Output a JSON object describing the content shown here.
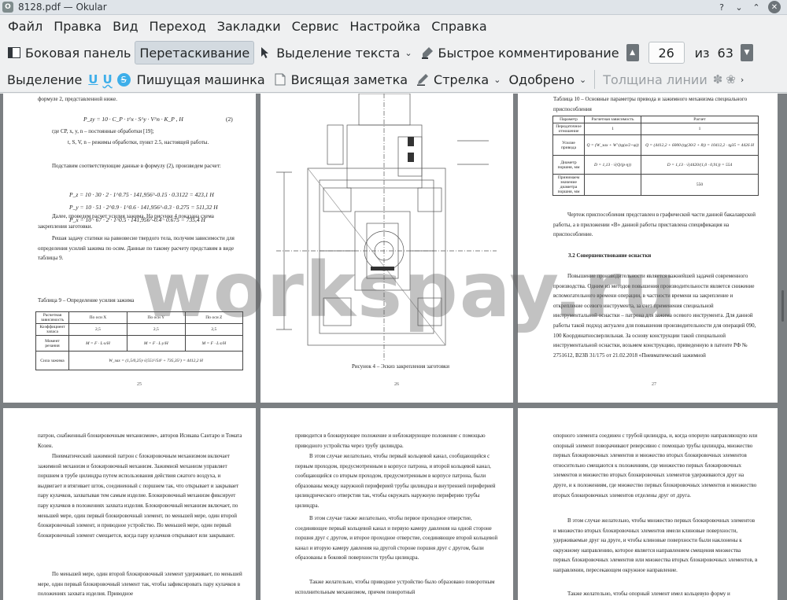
{
  "window": {
    "title": "8128.pdf  — Okular"
  },
  "menu": [
    "Файл",
    "Правка",
    "Вид",
    "Переход",
    "Закладки",
    "Сервис",
    "Настройка",
    "Справка"
  ],
  "toolbar": {
    "sidebar": "Боковая панель",
    "drag": "Перетаскивание",
    "text_select": "Выделение текста",
    "quick_comment": "Быстрое комментирование",
    "page_current": "26",
    "page_of": "из",
    "page_total": "63"
  },
  "annot_toolbar": {
    "highlight": "Выделение",
    "typewriter": "Пишущая машинка",
    "note": "Висящая заметка",
    "arrow": "Стрелка",
    "stamp": "Одобрено",
    "line_width": "Толщина линии"
  },
  "watermark": "workspay.ru",
  "pages": {
    "p25": {
      "top": "формуле 2, представленной ниже.",
      "formula_main": "P_zy = 10 · C_P · t^x · S^y · V^n · K_P , Н",
      "formula_num": "(2)",
      "where1": "где CP, x, y, n – постоянные обработки [19];",
      "where2": "t, S, V, n – режимы обработки, пункт 2.5, настоящей работы.",
      "sub": "Подставим соответствующие данные в формулу (2), произведем расчет:",
      "pz": "P_z = 10 · 30 · 2 · 1^0.75 · 141,956^-0.15 · 0.3122 = 423,1 Н",
      "py": "P_y = 10 · 51 · 2^0.9 · 1^0.6 · 141,956^-0.3 · 0.275 = 511,32 Н",
      "px": "P_x = 10 · 67 · 2 · 1^0.5 · 141,956^-0.4 · 0.675 = 735,4 Н",
      "para1": "Далее, проведем расчет усилия зажима. На рисунке 4 показана схема закрепления заготовки.",
      "para2": "Решая задачу статики на равновесие твердого тела, получим зависимости для определения усилий зажима по осям. Данные по такому расчету представим в виде таблицы 9.",
      "table_caption": "Таблица 9 – Определение усилия зажима",
      "table_head": [
        "Расчетная зависимость",
        "По оси X",
        "По оси Y",
        "По оси Z"
      ],
      "table_row1": [
        "Коэффициент запаса",
        "2,5",
        "2,5",
        "2,5"
      ],
      "table_row2": [
        "Момент резания",
        "M = F · L·x/H",
        "M = F · L·y/H",
        "M = F · L·z/H"
      ],
      "table_row3": [
        "Сила зажима",
        "W_зах = (1,5/0,25)·√(551²/54² + 735,35²) = 4412,2 Н"
      ],
      "num": "25"
    },
    "p26": {
      "caption": "Рисунок 4 – Эскиз закрепления заготовки",
      "num": "26"
    },
    "p27": {
      "table_caption": "Таблица 10 – Основные параметры привода и зажимного механизма специального приспособления",
      "table_head": [
        "Параметр",
        "Расчетная зависимость",
        "Расчет"
      ],
      "row1": [
        "Передаточное отношение",
        "1",
        "1"
      ],
      "row2": [
        "Усилие привода",
        "Q = (W_зах + W'·(tg(α/2+φ))",
        "Q = (4412,2 + 6000·(tg(30/2 + 8)) = 10412,2 · tg35 = 4426 Н"
      ],
      "row3": [
        "Диаметр поршня, мм",
        "D = 1,13 · √(Q/(p·η))",
        "D = 1,13 · √(4420/(1,0 · 0,91)) = 554"
      ],
      "row4": [
        "Принимаем значение диаметра поршня, мм",
        "",
        "550"
      ],
      "para1": "Чертеж приспособления представлен в графической части данной бакалаврской работы, а в приложении «В» данной работы приставлена спецификация на приспособление.",
      "heading": "3.2 Совершенствование оснастки",
      "para2": "Повышение производительности является важнейшей задачей современного производства. Одним из методов повышения производительности является снижение вспомогательного времени операции, в частности времени на закрепление и открепление осевого инструмента, за счет применения специальной инструментальной оснастки – патрона для зажима осевого инструмента. Для данной работы такой подход актуален для повышения производительности для операций 090, 100 Координатносверлильная. За основу конструкции такой специальной инструментальной оснастки, возьмем конструкцию, приведенную в патенте РФ № 2751612, В23В 31/175 от 21.02.2018 «Пневматический зажимной",
      "num": "27"
    },
    "p28": {
      "para1": "патрон, снабженный блокировочным механизмом», авторов Исикава Сантаро и Томата Козен.",
      "para2": "Пневматический зажимной патрон с блокировочным механизмом включает зажимной механизм и блокировочный механизм. Зажимной механизм управляет поршнем в трубе цилиндра путем использования действия сжатого воздуха, и выдвигает и втягивает шток, соединенный с поршнем так, что открывает и закрывает пару кулачков, захватывая тем самым изделие. Блокировочный механизм фиксирует пару кулачков в положениях захвата изделия. Блокировочный механизм включает, по меньшей мере, один первый блокировочный элемент, по меньшей мере, один второй блокировочный элемент, и приводное устройство. По меньшей мере, один первый блокировочный элемент смещается, когда пару кулачков открывают или закрывают.",
      "para3": "По меньшей мере, один второй блокировочный элемент удерживает, по меньшей мере, один первый блокировочный элемент так, чтобы зафиксировать пару кулачков в положениях захвата изделия. Приводное"
    },
    "p29": {
      "para1": "приводится в блокирующее положение и неблокирующее положение с помощью приводного устройства через трубу цилиндра.",
      "para2": "В этом случае желательно, чтобы первый кольцевой канал, сообщающийся с первым проходом, предусмотренным в корпусе патрона, и второй кольцевой канал, сообщающийся со вторым проходом, предусмотренным в корпусе патрона, были образованы между наружной периферией трубы цилиндра и внутренней периферией цилиндрического отверстия так, чтобы окружать наружную периферию трубы цилиндра.",
      "para3": "В этом случае также желательно, чтобы первое проходное отверстие, соединяющее первый кольцевой канал и первую камеру давления на одной стороне поршня друг с другом, и второе проходное отверстие, соединяющее второй кольцевой канал и вторую камеру давления на другой стороне поршня друг с другом, были образованы в боковой поверхности трубы цилиндра.",
      "para4": "Также желательно, чтобы приводное устройство было образовано поворотным исполнительным механизмом, причем поворотный"
    },
    "p30": {
      "para1": "опорного элемента соединен с трубой цилиндра, и, когда опорную направляющую или опорный элемент поворачивают реверсивно с помощью трубы цилиндра, множество первых блокировочных элементов и множество вторых блокировочных элементов относительно смещаются к положениям, где множество первых блокировочных элементов и множество вторых блокировочных элементов удерживаются друг на друге, и к положениям, где множество первых блокировочных элементов и множество вторых блокировочных элементов отделены друг от друга.",
      "para2": "В этом случае желательно, чтобы множество первых блокировочных элементов и множество вторых блокировочных элементов имели клиновые поверхности, удерживаемые друг на друге, и чтобы клиновые поверхности были наклонены к окружному направлению, которое является направлением смещения множества первых блокировочных элементов или множества вторых блокировочных элементов, в направлении, пересекающем окружное направление.",
      "para3": "Также желательно, чтобы опорный элемент имел кольцевую форму и"
    }
  }
}
